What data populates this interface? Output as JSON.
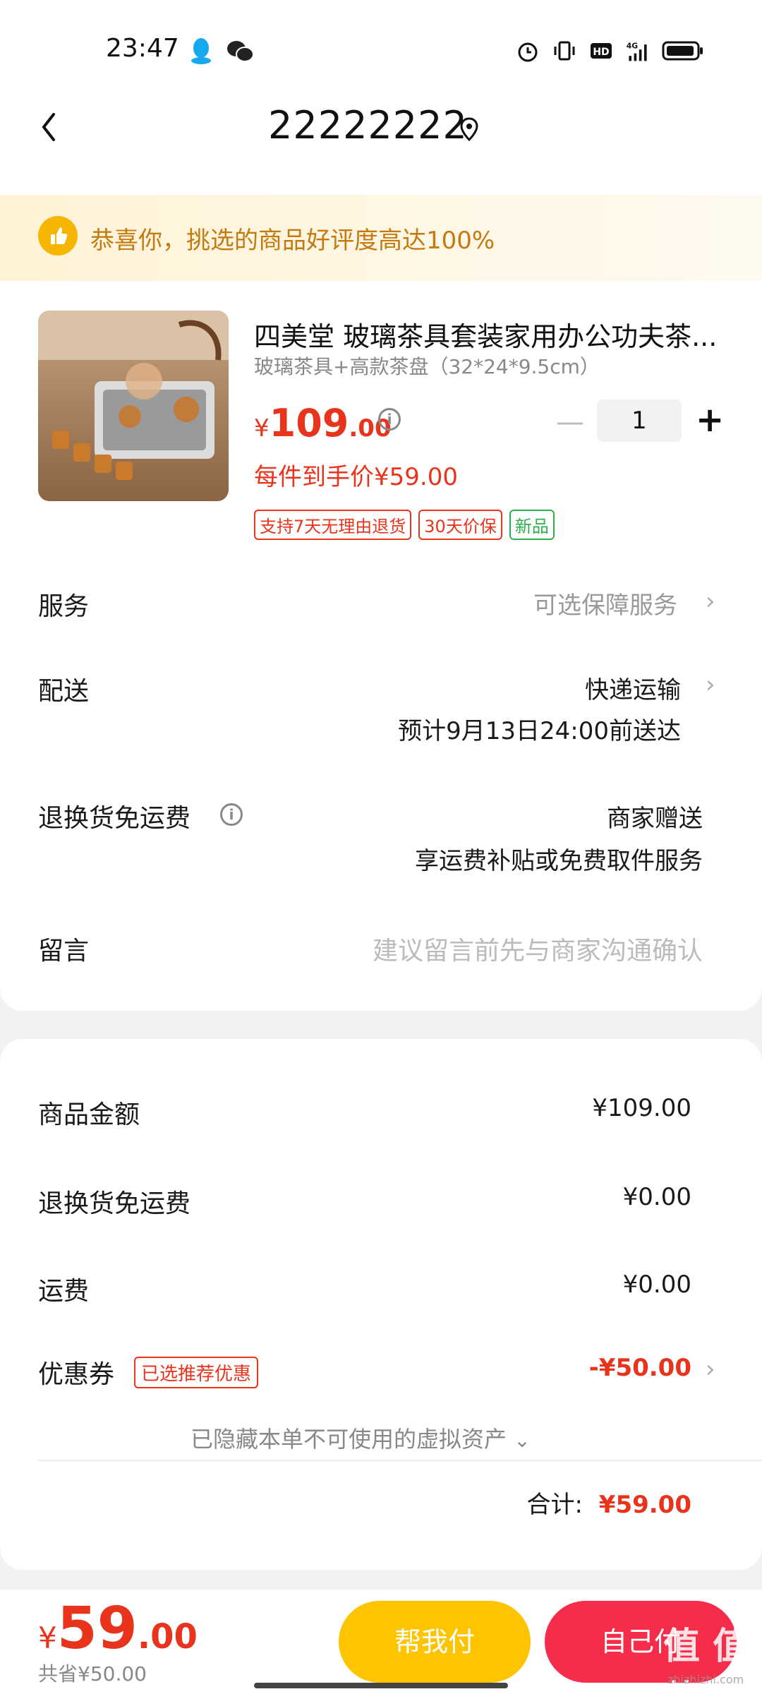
{
  "status_bar": {
    "time": "23:47",
    "network": "4G"
  },
  "header": {
    "title": "22222222",
    "back_icon": "chevron-left-icon",
    "location_icon": "location-pin-icon"
  },
  "banner": {
    "icon": "thumbs-up-icon",
    "text": "恭喜你，挑选的商品好评度高达100%"
  },
  "product": {
    "title": "四美堂 玻璃茶具套装家用办公功夫茶...",
    "spec": "玻璃茶具+高款茶盘（32*24*9.5cm）",
    "price_currency": "¥",
    "price_int": "109",
    "price_dec": ".00",
    "quantity": "1",
    "deal_price": "每件到手价¥59.00",
    "tags": [
      "支持7天无理由退货",
      "30天价保",
      "新品"
    ]
  },
  "rows": {
    "service_label": "服务",
    "service_value": "可选保障服务",
    "delivery_label": "配送",
    "delivery_value": "快递运输",
    "delivery_eta": "预计9月13日24:00前送达",
    "return_label": "退换货免运费",
    "return_value": "商家赠送",
    "return_desc": "享运费补贴或免费取件服务",
    "message_label": "留言",
    "message_placeholder": "建议留言前先与商家沟通确认"
  },
  "summary": {
    "goods_label": "商品金额",
    "goods_value": "¥109.00",
    "return_fee_label": "退换货免运费",
    "return_fee_value": "¥0.00",
    "shipping_label": "运费",
    "shipping_value": "¥0.00",
    "coupon_label": "优惠券",
    "coupon_tag": "已选推荐优惠",
    "coupon_value": "-¥50.00",
    "hidden_note": "已隐藏本单不可使用的虚拟资产",
    "total_label": "合计:",
    "total_value": "¥59.00"
  },
  "bottom": {
    "currency": "¥",
    "total_int": "59",
    "total_dec": ".00",
    "saved": "共省¥50.00",
    "help_pay": "帮我付",
    "self_pay": "自己付"
  },
  "watermark": {
    "text": "值 值 值",
    "site": "zhizhizhi.com"
  },
  "colors": {
    "price_red": "#e8341c",
    "banner_orange": "#c47a10",
    "help_pay_yellow": "#ffc400",
    "self_pay_red": "#f52d4a",
    "tag_green": "#2eb04a"
  }
}
